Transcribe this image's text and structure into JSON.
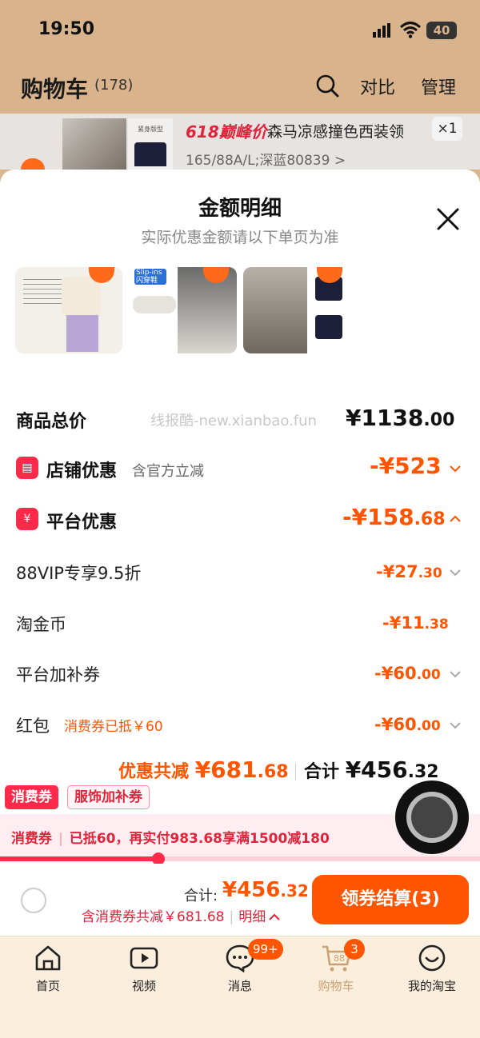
{
  "status": {
    "time": "19:50",
    "battery": "40"
  },
  "header": {
    "title": "购物车",
    "count": "(178)",
    "compare": "对比",
    "manage": "管理"
  },
  "bg_product": {
    "promo": "618巅峰价",
    "name": "森马凉感撞色西装领",
    "quantity": "×1",
    "spec": "165/88A/L;深蓝80839 >",
    "thumb_tag": "紧身版型"
  },
  "sheet": {
    "title": "金额明细",
    "subtitle": "实际优惠金额请以下单页为准",
    "thumb_captions": [
      "Slip-ins",
      "闪穿鞋"
    ],
    "watermark": "线报酷-new.xianbao.fun",
    "total_label": "商品总价",
    "total_main": "¥1138",
    "total_dec": ".00",
    "store": {
      "label": "店铺优惠",
      "note": "含官方立减",
      "main": "-¥523",
      "dec": ""
    },
    "platform": {
      "label": "平台优惠",
      "main": "-¥158",
      "dec": ".68"
    },
    "items": [
      {
        "label": "88VIP专享9.5折",
        "note": "",
        "main": "-¥27",
        "dec": ".30",
        "chevron": true
      },
      {
        "label": "淘金币",
        "note": "",
        "main": "-¥11",
        "dec": ".38",
        "chevron": false
      },
      {
        "label": "平台加补券",
        "note": "",
        "main": "-¥60",
        "dec": ".00",
        "chevron": true
      },
      {
        "label": "红包",
        "note": "消费券已抵￥60",
        "main": "-¥60",
        "dec": ".00",
        "chevron": true
      }
    ],
    "summary": {
      "discount_label": "优惠共减",
      "discount_main": "¥681",
      "discount_dec": ".68",
      "sum_label": "合计",
      "sum_main": "¥456",
      "sum_dec": ".32"
    }
  },
  "promo": {
    "tag1": "消费券",
    "tag2": "服饰加补券",
    "bar_label": "消费券",
    "bar_text": "已抵60，再实付983.68享满1500减180",
    "progress": 0.33
  },
  "checkout": {
    "total_label": "合计:",
    "total_main": "¥456",
    "total_dec": ".32",
    "sub": "含消费券共减￥681.68",
    "detail": "明细",
    "button": "领券结算(3)"
  },
  "tabs": [
    {
      "label": "首页",
      "icon": "home-icon"
    },
    {
      "label": "视频",
      "icon": "video-icon"
    },
    {
      "label": "消息",
      "icon": "message-icon",
      "badge": "99+"
    },
    {
      "label": "购物车",
      "icon": "cart-icon",
      "badge": "3",
      "cart_num": "88"
    },
    {
      "label": "我的淘宝",
      "icon": "profile-icon"
    }
  ],
  "colors": {
    "accent": "#ff5500",
    "red": "#ff2a4a",
    "header_bg": "#d8b38b",
    "tabbar_bg": "#fbeedd"
  }
}
